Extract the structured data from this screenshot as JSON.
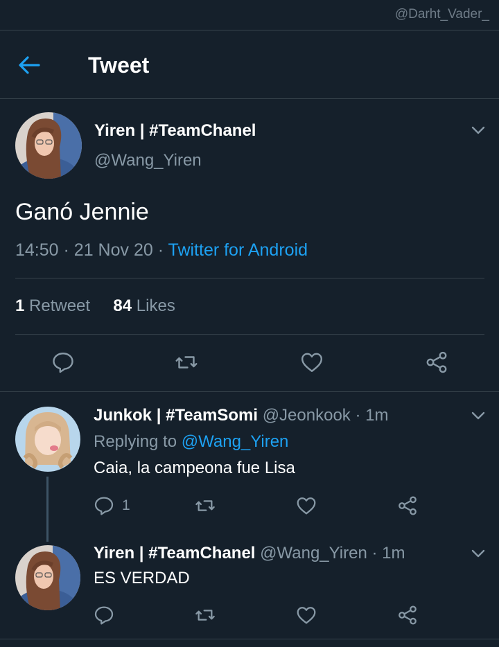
{
  "watermark": "@Darht_Vader_",
  "header": {
    "title": "Tweet"
  },
  "main_tweet": {
    "author_name": "Yiren | #TeamChanel",
    "author_handle": "@Wang_Yiren",
    "text": "Ganó Jennie",
    "time": "14:50",
    "date": "21 Nov 20",
    "source": "Twitter for Android",
    "dot": "·",
    "retweet_count": "1",
    "retweet_label": "Retweet",
    "like_count": "84",
    "like_label": "Likes"
  },
  "replies": [
    {
      "author_name": "Junkok | #TeamSomi",
      "handle_time": "@Jeonkook · 1m",
      "replying_prefix": "Replying to ",
      "replying_to": "@Wang_Yiren",
      "text": "Caia, la campeona fue Lisa",
      "reply_count": "1"
    },
    {
      "author_name": "Yiren | #TeamChanel",
      "handle_time": "@Wang_Yiren · 1m",
      "text": "ES VERDAD"
    }
  ],
  "icons": {
    "back": "arrow-left-icon",
    "chevron": "chevron-down-icon",
    "reply": "reply-bubble-icon",
    "retweet": "retweet-icon",
    "like": "heart-icon",
    "share": "share-icon"
  },
  "colors": {
    "background": "#15202b",
    "accent": "#1da1f2",
    "muted": "#8899a6",
    "divider": "#38444d"
  }
}
